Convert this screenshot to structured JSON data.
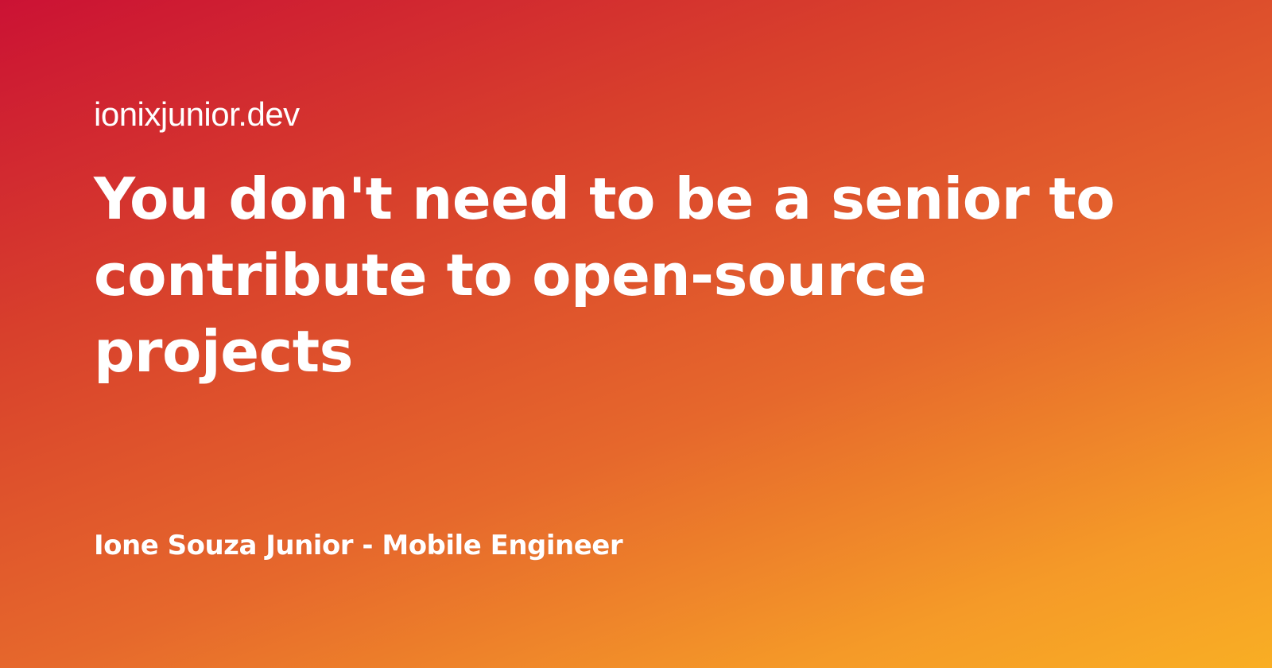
{
  "site": "ionixjunior.dev",
  "title": "You don't need to be a senior to contribute to open-source projects",
  "author": "Ione Souza Junior - Mobile Engineer",
  "colors": {
    "gradient_start": "#cb1234",
    "gradient_end": "#f9ae24",
    "text": "#ffffff"
  }
}
